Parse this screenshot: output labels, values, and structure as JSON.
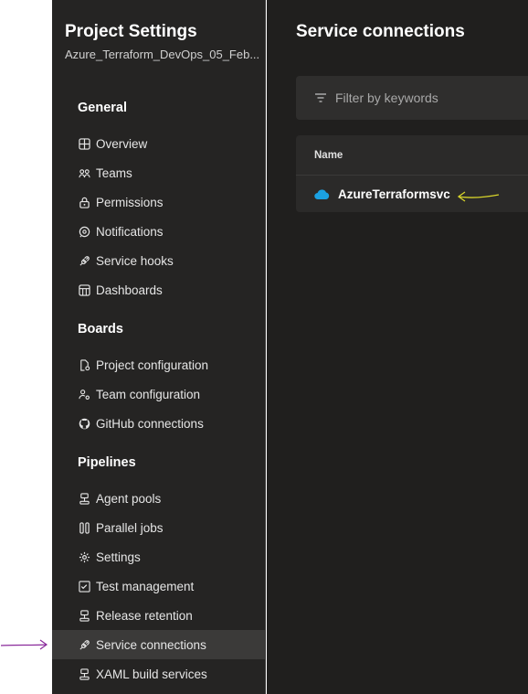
{
  "sidebar": {
    "project_title": "Project Settings",
    "project_name": "Azure_Terraform_DevOps_05_Feb...",
    "sections": {
      "general": {
        "header": "General",
        "items": [
          {
            "label": "Overview",
            "icon": "overview-icon"
          },
          {
            "label": "Teams",
            "icon": "teams-icon"
          },
          {
            "label": "Permissions",
            "icon": "lock-icon"
          },
          {
            "label": "Notifications",
            "icon": "notification-icon"
          },
          {
            "label": "Service hooks",
            "icon": "plug-icon"
          },
          {
            "label": "Dashboards",
            "icon": "dashboard-icon"
          }
        ]
      },
      "boards": {
        "header": "Boards",
        "items": [
          {
            "label": "Project configuration",
            "icon": "settings-file-icon"
          },
          {
            "label": "Team configuration",
            "icon": "team-settings-icon"
          },
          {
            "label": "GitHub connections",
            "icon": "github-icon"
          }
        ]
      },
      "pipelines": {
        "header": "Pipelines",
        "items": [
          {
            "label": "Agent pools",
            "icon": "agent-pool-icon"
          },
          {
            "label": "Parallel jobs",
            "icon": "parallel-jobs-icon"
          },
          {
            "label": "Settings",
            "icon": "gear-icon"
          },
          {
            "label": "Test management",
            "icon": "test-icon"
          },
          {
            "label": "Release retention",
            "icon": "release-icon"
          },
          {
            "label": "Service connections",
            "icon": "plug-icon",
            "selected": true
          },
          {
            "label": "XAML build services",
            "icon": "build-icon"
          }
        ]
      }
    }
  },
  "main": {
    "title": "Service connections",
    "filter_placeholder": "Filter by keywords",
    "table": {
      "column_name": "Name",
      "rows": [
        {
          "name": "AzureTerraformsvc",
          "icon": "azure-cloud-icon"
        }
      ]
    }
  },
  "colors": {
    "sidebar_bg": "#252423",
    "main_bg": "#201f1e",
    "selected_bg": "#3b3a39",
    "azure_blue": "#1ba1e2",
    "annotation_yellow": "#d6d32a",
    "annotation_purple": "#8a2a9b"
  }
}
